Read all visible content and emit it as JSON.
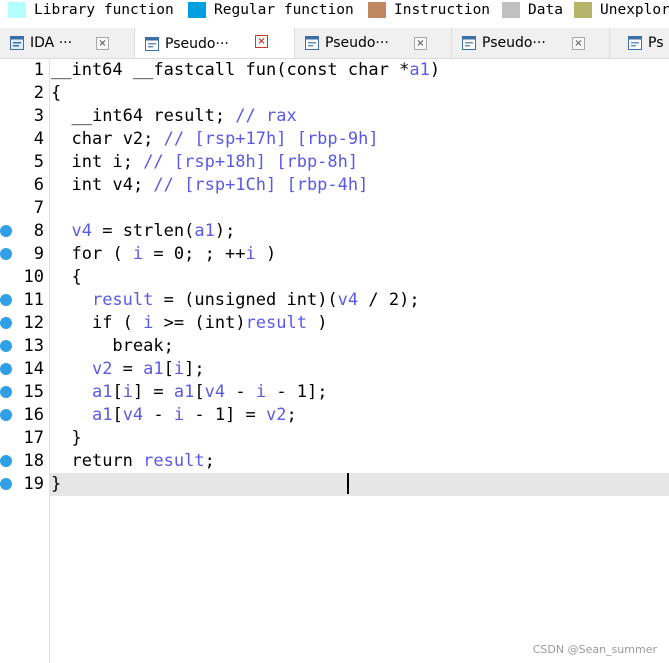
{
  "legend": [
    {
      "label": "Library function",
      "color": "#b4ffff"
    },
    {
      "label": "Regular function",
      "color": "#00a0e0"
    },
    {
      "label": "Instruction",
      "color": "#c08860"
    },
    {
      "label": "Data",
      "color": "#c0c0c0"
    },
    {
      "label": "Unexplored",
      "color": "#b4b46a"
    }
  ],
  "tabs": [
    {
      "label": "IDA ···",
      "icon": "ida-view-icon",
      "active": false
    },
    {
      "label": "Pseudo···",
      "icon": "pseudocode-icon",
      "active": true
    },
    {
      "label": "Pseudo···",
      "icon": "pseudocode-icon",
      "active": false
    },
    {
      "label": "Pseudo···",
      "icon": "pseudocode-icon",
      "active": false
    },
    {
      "label": "Ps",
      "icon": "pseudocode-icon",
      "active": false
    }
  ],
  "code": {
    "lines": [
      {
        "n": "1",
        "bp": false,
        "text": "__int64 __fastcall fun(const char *a1)"
      },
      {
        "n": "2",
        "bp": false,
        "text": "{"
      },
      {
        "n": "3",
        "bp": false,
        "text": "  __int64 result; // rax"
      },
      {
        "n": "4",
        "bp": false,
        "text": "  char v2; // [rsp+17h] [rbp-9h]"
      },
      {
        "n": "5",
        "bp": false,
        "text": "  int i; // [rsp+18h] [rbp-8h]"
      },
      {
        "n": "6",
        "bp": false,
        "text": "  int v4; // [rsp+1Ch] [rbp-4h]"
      },
      {
        "n": "7",
        "bp": false,
        "text": ""
      },
      {
        "n": "8",
        "bp": true,
        "text": "  v4 = strlen(a1);"
      },
      {
        "n": "9",
        "bp": true,
        "text": "  for ( i = 0; ; ++i )"
      },
      {
        "n": "10",
        "bp": false,
        "text": "  {"
      },
      {
        "n": "11",
        "bp": true,
        "text": "    result = (unsigned int)(v4 / 2);"
      },
      {
        "n": "12",
        "bp": true,
        "text": "    if ( i >= (int)result )"
      },
      {
        "n": "13",
        "bp": true,
        "text": "      break;"
      },
      {
        "n": "14",
        "bp": true,
        "text": "    v2 = a1[i];"
      },
      {
        "n": "15",
        "bp": true,
        "text": "    a1[i] = a1[v4 - i - 1];"
      },
      {
        "n": "16",
        "bp": true,
        "text": "    a1[v4 - i - 1] = v2;"
      },
      {
        "n": "17",
        "bp": false,
        "text": "  }"
      },
      {
        "n": "18",
        "bp": true,
        "text": "  return result;"
      },
      {
        "n": "19",
        "bp": true,
        "text": "}"
      }
    ],
    "current_line": "19"
  },
  "watermark": "CSDN @Sean_summer"
}
